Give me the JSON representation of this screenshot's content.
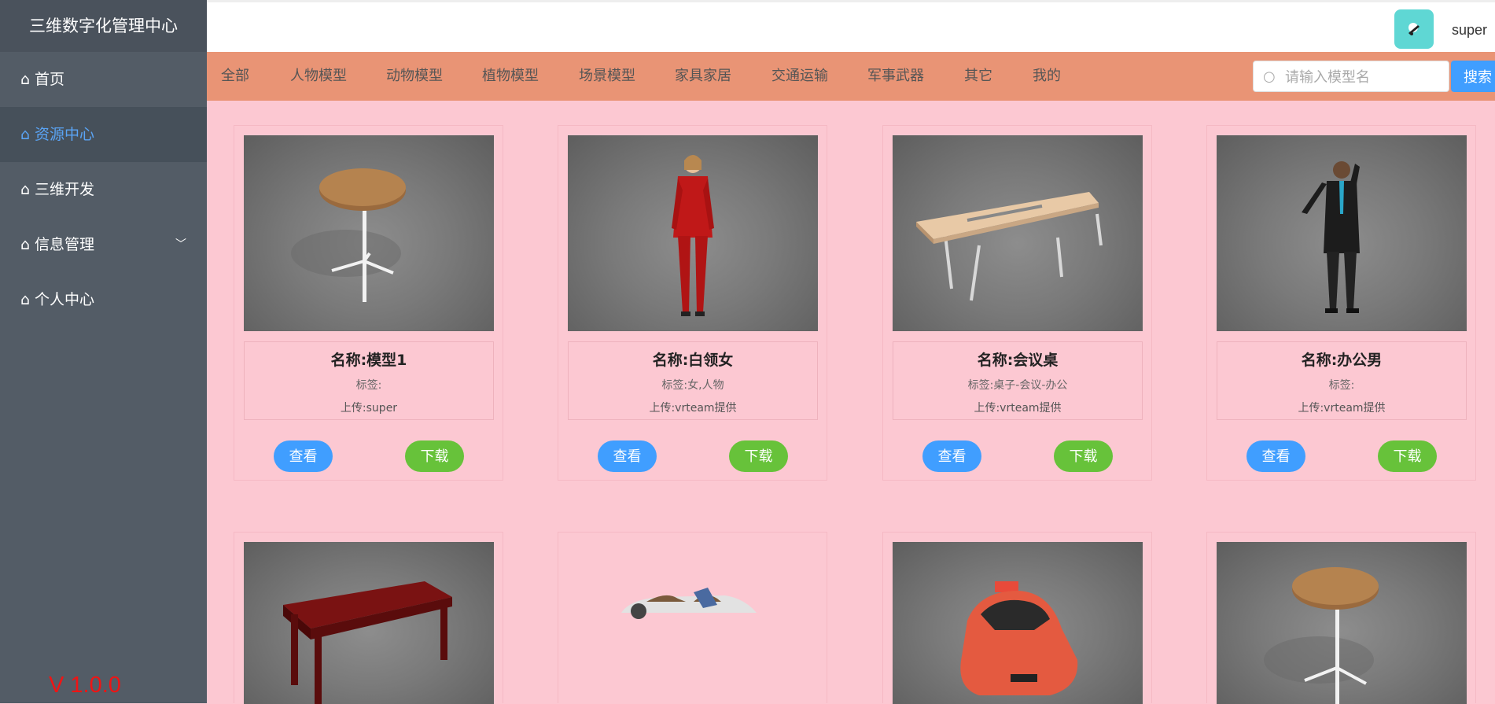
{
  "sidebar": {
    "brand": "三维数字化管理中心",
    "items": [
      {
        "label": "首页"
      },
      {
        "label": "资源中心"
      },
      {
        "label": "三维开发"
      },
      {
        "label": "信息管理"
      },
      {
        "label": "个人中心"
      }
    ],
    "version": "V 1.0.0"
  },
  "header": {
    "username": "super"
  },
  "categories": [
    "全部",
    "人物模型",
    "动物模型",
    "植物模型",
    "场景模型",
    "家具家居",
    "交通运输",
    "军事武器",
    "其它",
    "我的"
  ],
  "search": {
    "placeholder": "请输入模型名",
    "button": "搜索"
  },
  "buttons": {
    "view": "查看",
    "download": "下载"
  },
  "cards": [
    {
      "name": "名称:模型1",
      "tag": "标签:",
      "uploader": "上传:super",
      "image": "round-table"
    },
    {
      "name": "名称:白领女",
      "tag": "标签:女,人物",
      "uploader": "上传:vrteam提供",
      "image": "woman-red-suit"
    },
    {
      "name": "名称:会议桌",
      "tag": "标签:桌子-会议-办公",
      "uploader": "上传:vrteam提供",
      "image": "conference-table"
    },
    {
      "name": "名称:办公男",
      "tag": "标签:",
      "uploader": "上传:vrteam提供",
      "image": "businessman"
    },
    {
      "image": "red-table"
    },
    {
      "image": "convertible-car"
    },
    {
      "image": "taxi"
    },
    {
      "image": "round-table"
    }
  ]
}
